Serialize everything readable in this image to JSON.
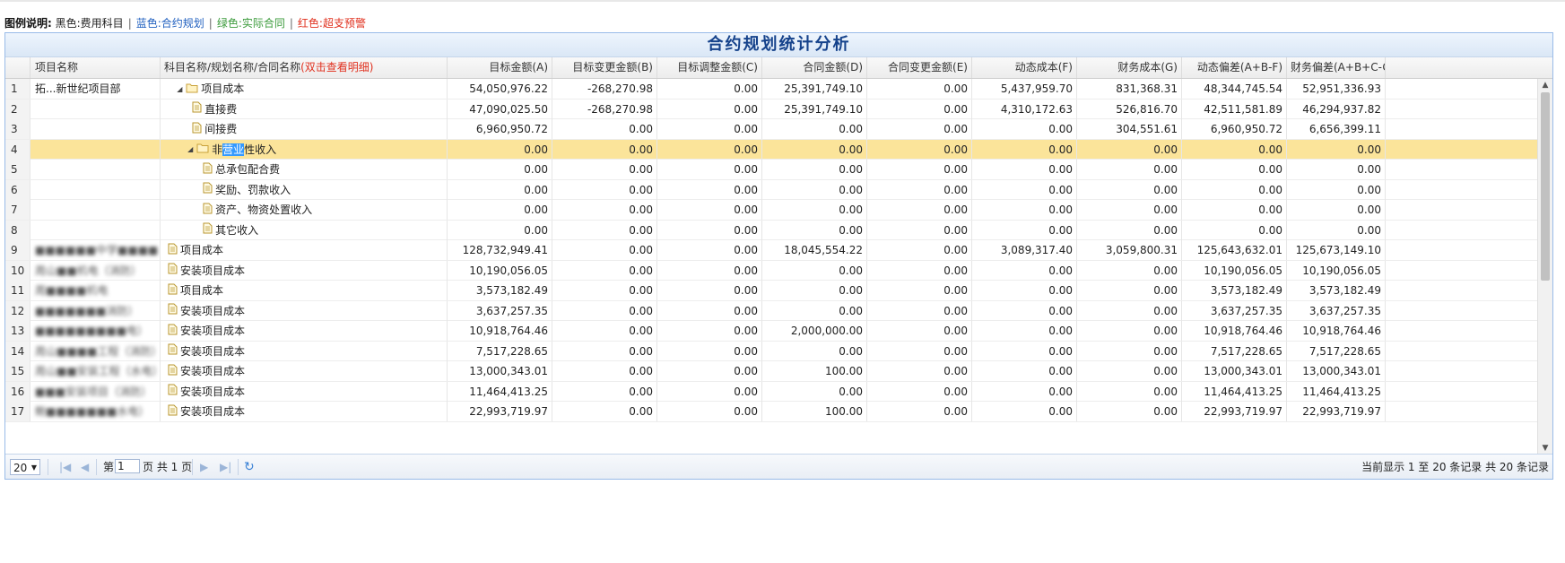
{
  "legend": {
    "label": "图例说明:",
    "items": [
      {
        "text": "黑色:费用科目",
        "color": "#222222"
      },
      {
        "text": "蓝色:合约规划",
        "color": "#1f5fbf"
      },
      {
        "text": "绿色:实际合同",
        "color": "#3a9a3a"
      },
      {
        "text": "红色:超支预警",
        "color": "#e0301e"
      }
    ]
  },
  "title": "合约规划统计分析",
  "columns": {
    "project": "项目名称",
    "subject": "科目名称/规划名称/合同名称",
    "subject_hint": "(双击查看明细)",
    "target": "目标金额(A)",
    "target_change": "目标变更金额(B)",
    "target_adjust": "目标调整金额(C)",
    "contract": "合同金额(D)",
    "contract_change": "合同变更金额(E)",
    "dynamic_cost": "动态成本(F)",
    "finance_cost": "财务成本(G)",
    "dynamic_dev": "动态偏差(A+B-F)",
    "finance_dev": "财务偏差(A+B+C-G)"
  },
  "rows": [
    {
      "n": "1",
      "project": "拓...新世纪项目部",
      "subject": "项目成本",
      "icon": "folder",
      "level": 0,
      "expand": true,
      "vals": [
        "54,050,976.22",
        "-268,270.98",
        "0.00",
        "25,391,749.10",
        "0.00",
        "5,437,959.70",
        "831,368.31",
        "48,344,745.54",
        "52,951,336.93"
      ]
    },
    {
      "n": "2",
      "project": "",
      "subject": "直接费",
      "icon": "doc",
      "level": 1,
      "vals": [
        "47,090,025.50",
        "-268,270.98",
        "0.00",
        "25,391,749.10",
        "0.00",
        "4,310,172.63",
        "526,816.70",
        "42,511,581.89",
        "46,294,937.82"
      ]
    },
    {
      "n": "3",
      "project": "",
      "subject": "间接费",
      "icon": "doc",
      "level": 1,
      "vals": [
        "6,960,950.72",
        "0.00",
        "0.00",
        "0.00",
        "0.00",
        "0.00",
        "304,551.61",
        "6,960,950.72",
        "6,656,399.11"
      ]
    },
    {
      "n": "4",
      "project": "",
      "subject_pre": "非",
      "subject_hl": "营业",
      "subject_post": "性收入",
      "icon": "folder",
      "level": 0.7,
      "expand": true,
      "selected": true,
      "vals": [
        "0.00",
        "0.00",
        "0.00",
        "0.00",
        "0.00",
        "0.00",
        "0.00",
        "0.00",
        "0.00"
      ]
    },
    {
      "n": "5",
      "project": "",
      "subject": "总承包配合费",
      "icon": "doc",
      "level": 1.7,
      "vals": [
        "0.00",
        "0.00",
        "0.00",
        "0.00",
        "0.00",
        "0.00",
        "0.00",
        "0.00",
        "0.00"
      ]
    },
    {
      "n": "6",
      "project": "",
      "subject": "奖励、罚款收入",
      "icon": "doc",
      "level": 1.7,
      "vals": [
        "0.00",
        "0.00",
        "0.00",
        "0.00",
        "0.00",
        "0.00",
        "0.00",
        "0.00",
        "0.00"
      ]
    },
    {
      "n": "7",
      "project": "",
      "subject": "资产、物资处置收入",
      "icon": "doc",
      "level": 1.7,
      "vals": [
        "0.00",
        "0.00",
        "0.00",
        "0.00",
        "0.00",
        "0.00",
        "0.00",
        "0.00",
        "0.00"
      ]
    },
    {
      "n": "8",
      "project": "",
      "subject": "其它收入",
      "icon": "doc",
      "level": 1.7,
      "vals": [
        "0.00",
        "0.00",
        "0.00",
        "0.00",
        "0.00",
        "0.00",
        "0.00",
        "0.00",
        "0.00"
      ]
    },
    {
      "n": "9",
      "project": "■■■■■■中学■■■■",
      "subject": "项目成本",
      "icon": "doc",
      "level": -0.6,
      "blur": true,
      "vals": [
        "128,732,949.41",
        "0.00",
        "0.00",
        "18,045,554.22",
        "0.00",
        "3,089,317.40",
        "3,059,800.31",
        "125,643,632.01",
        "125,673,149.10"
      ]
    },
    {
      "n": "10",
      "project": "周山■■机电（消防）",
      "subject": "安装项目成本",
      "icon": "doc",
      "level": -0.6,
      "blur": true,
      "vals": [
        "10,190,056.05",
        "0.00",
        "0.00",
        "0.00",
        "0.00",
        "0.00",
        "0.00",
        "10,190,056.05",
        "10,190,056.05"
      ]
    },
    {
      "n": "11",
      "project": "周■■■■机电",
      "subject": "项目成本",
      "icon": "doc",
      "level": -0.6,
      "blur": true,
      "vals": [
        "3,573,182.49",
        "0.00",
        "0.00",
        "0.00",
        "0.00",
        "0.00",
        "0.00",
        "3,573,182.49",
        "3,573,182.49"
      ]
    },
    {
      "n": "12",
      "project": "■■■■■■■消防）",
      "subject": "安装项目成本",
      "icon": "doc",
      "level": -0.6,
      "blur": true,
      "vals": [
        "3,637,257.35",
        "0.00",
        "0.00",
        "0.00",
        "0.00",
        "0.00",
        "0.00",
        "3,637,257.35",
        "3,637,257.35"
      ]
    },
    {
      "n": "13",
      "project": "■■■■■■■■■电）",
      "subject": "安装项目成本",
      "icon": "doc",
      "level": -0.6,
      "blur": true,
      "vals": [
        "10,918,764.46",
        "0.00",
        "0.00",
        "2,000,000.00",
        "0.00",
        "0.00",
        "0.00",
        "10,918,764.46",
        "10,918,764.46"
      ]
    },
    {
      "n": "14",
      "project": "周山■■■■工程（消防）",
      "subject": "安装项目成本",
      "icon": "doc",
      "level": -0.6,
      "blur": true,
      "vals": [
        "7,517,228.65",
        "0.00",
        "0.00",
        "0.00",
        "0.00",
        "0.00",
        "0.00",
        "7,517,228.65",
        "7,517,228.65"
      ]
    },
    {
      "n": "15",
      "project": "周山■■安装工程（水电）",
      "subject": "安装项目成本",
      "icon": "doc",
      "level": -0.6,
      "blur": true,
      "vals": [
        "13,000,343.01",
        "0.00",
        "0.00",
        "100.00",
        "0.00",
        "0.00",
        "0.00",
        "13,000,343.01",
        "13,000,343.01"
      ]
    },
    {
      "n": "16",
      "project": "■■■安装项目（消防）",
      "subject": "安装项目成本",
      "icon": "doc",
      "level": -0.6,
      "blur": true,
      "vals": [
        "11,464,413.25",
        "0.00",
        "0.00",
        "0.00",
        "0.00",
        "0.00",
        "0.00",
        "11,464,413.25",
        "11,464,413.25"
      ]
    },
    {
      "n": "17",
      "project": "鲍■■■■■■■水电）",
      "subject": "安装项目成本",
      "icon": "doc",
      "level": -0.6,
      "blur": true,
      "vals": [
        "22,993,719.97",
        "0.00",
        "0.00",
        "100.00",
        "0.00",
        "0.00",
        "0.00",
        "22,993,719.97",
        "22,993,719.97"
      ]
    }
  ],
  "pager": {
    "page_size": "20",
    "page_prefix": "第",
    "page_value": "1",
    "page_suffix": "页 共 1 页",
    "summary": "当前显示 1 至 20 条记录 共 20 条记录"
  },
  "colors": {
    "accent": "#15428b",
    "selected_row": "#fbe49a",
    "link": "#3b82d6"
  }
}
